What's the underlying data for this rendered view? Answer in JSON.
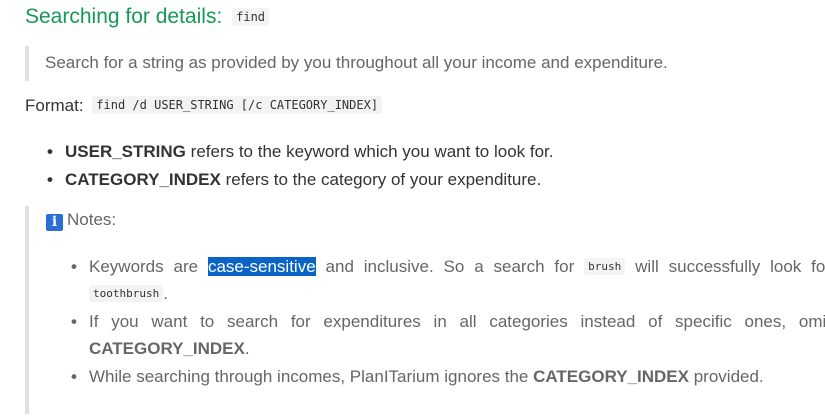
{
  "heading": {
    "text": "Searching for details:",
    "code": "find"
  },
  "description": "Search for a string as provided by you throughout all your income and expenditure.",
  "format": {
    "label": "Format:",
    "code": "find /d USER_STRING [/c CATEGORY_INDEX]"
  },
  "params": [
    {
      "name": "USER_STRING",
      "desc": "refers to the keyword which you want to look for."
    },
    {
      "name": "CATEGORY_INDEX",
      "desc": "refers to the category of your expenditure."
    }
  ],
  "notes": {
    "icon": "info-icon",
    "title": "Notes:",
    "items": {
      "n1": {
        "pre": "Keywords are",
        "highlight": "case-sensitive",
        "mid": "and inclusive. So a search for",
        "code1": "brush",
        "mid2": "will successfully look for",
        "code2": "toothbrush",
        "post": "."
      },
      "n2": {
        "pre": "If you want to search for expenditures in all categories instead of specific ones, omit",
        "bold": "CATEGORY_INDEX",
        "post": "."
      },
      "n3": {
        "pre": "While searching through incomes, PlanITarium ignores the",
        "bold": "CATEGORY_INDEX",
        "post": "provided."
      }
    }
  },
  "colors": {
    "heading": "#159957",
    "highlight": "#0b63c8",
    "info_icon": "#2b6fd6"
  }
}
